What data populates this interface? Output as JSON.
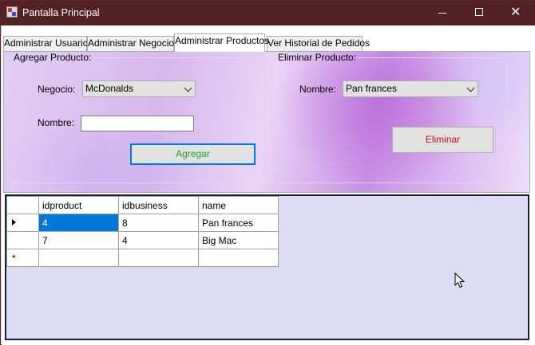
{
  "window": {
    "title": "Pantalla Principal"
  },
  "window_controls": {
    "minimize": "minimize-icon",
    "maximize": "maximize-icon",
    "close": "close-icon",
    "close_glyph": "✕"
  },
  "tabs": [
    {
      "label": "Administrar Usuarios",
      "selected": false
    },
    {
      "label": "Administrar Negocios",
      "selected": false
    },
    {
      "label": "Administrar Productos",
      "selected": true
    },
    {
      "label": "Ver Historial de Pedidos",
      "selected": false
    }
  ],
  "add_group": {
    "legend": "Agregar Producto:",
    "business_label": "Negocio:",
    "business_value": "McDonalds",
    "name_label": "Nombre:",
    "name_value": "",
    "add_button": "Agregar",
    "add_button_color": "#22a022"
  },
  "delete_group": {
    "legend": "Eliminar Producto:",
    "name_label": "Nombre:",
    "name_value": "Pan frances",
    "delete_button": "Eliminar",
    "delete_button_color": "#c0101a"
  },
  "grid": {
    "columns": [
      "idproduct",
      "idbusiness",
      "name"
    ],
    "rows": [
      {
        "idproduct": "4",
        "idbusiness": "8",
        "name": "Pan frances",
        "current": true
      },
      {
        "idproduct": "7",
        "idbusiness": "4",
        "name": "Big Mac",
        "current": false
      }
    ],
    "new_row_glyph": "*",
    "selection_color": "#0078d7"
  }
}
